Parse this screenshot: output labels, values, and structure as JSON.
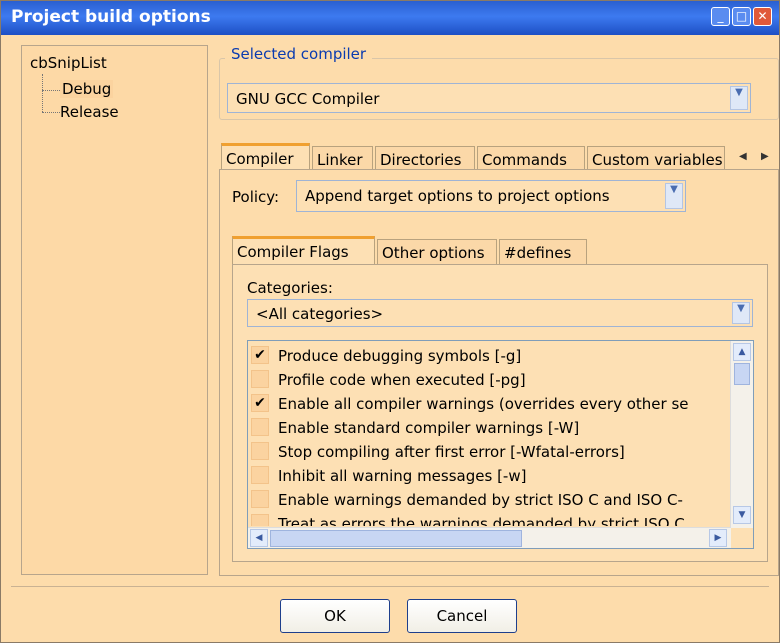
{
  "window": {
    "title": "Project build options"
  },
  "tree": {
    "root": "cbSnipList",
    "children": [
      "Debug",
      "Release"
    ]
  },
  "compiler_group": {
    "label": "Selected compiler",
    "value": "GNU GCC Compiler"
  },
  "tabs": [
    "Compiler",
    "Linker",
    "Directories",
    "Commands",
    "Custom variables"
  ],
  "policy": {
    "label": "Policy:",
    "value": "Append target options to project options"
  },
  "subtabs": [
    "Compiler Flags",
    "Other options",
    "#defines"
  ],
  "categories": {
    "label": "Categories:",
    "value": "<All categories>"
  },
  "flags": [
    {
      "checked": true,
      "label": "Produce debugging symbols  [-g]"
    },
    {
      "checked": false,
      "label": "Profile code when executed  [-pg]"
    },
    {
      "checked": true,
      "label": "Enable all compiler warnings (overrides every other se"
    },
    {
      "checked": false,
      "label": "Enable standard compiler warnings  [-W]"
    },
    {
      "checked": false,
      "label": "Stop compiling after first error  [-Wfatal-errors]"
    },
    {
      "checked": false,
      "label": "Inhibit all warning messages  [-w]"
    },
    {
      "checked": false,
      "label": "Enable warnings demanded by strict ISO C and ISO C-"
    },
    {
      "checked": false,
      "label": "Treat as errors the warnings demanded by strict ISO C"
    }
  ],
  "buttons": {
    "ok": "OK",
    "cancel": "Cancel"
  },
  "icons": {
    "check": "✔",
    "dropdown": "chevron-down-icon"
  },
  "colors": {
    "background": "#fddcab",
    "title_blue": "#2a5fd0",
    "group_label": "#0a3bb0",
    "active_tab_accent": "#f0a030"
  }
}
